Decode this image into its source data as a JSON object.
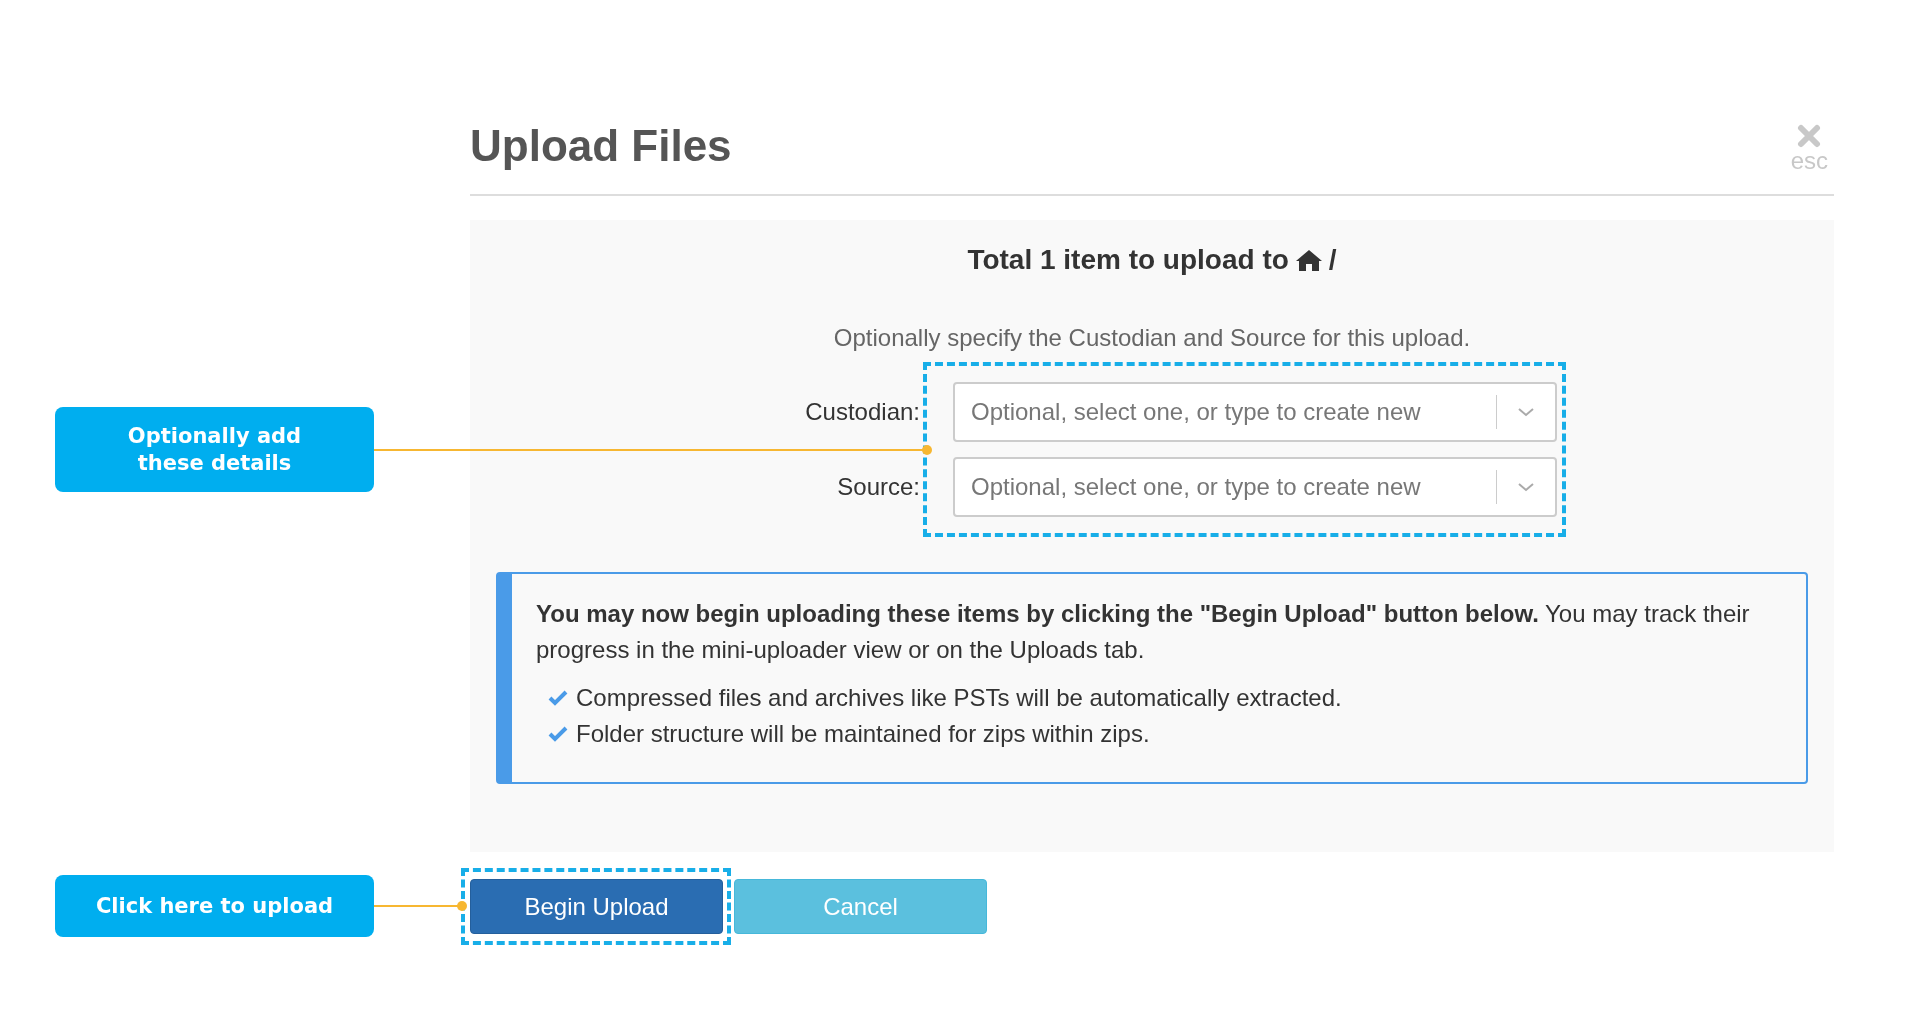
{
  "dialog": {
    "title": "Upload Files",
    "close_hint": "esc"
  },
  "summary": {
    "text": "Total 1 item to upload to",
    "path": "/"
  },
  "instructions": "Optionally specify the Custodian and Source for this upload.",
  "fields": [
    {
      "label": "Custodian:",
      "placeholder": "Optional, select one, or type to create new"
    },
    {
      "label": "Source:",
      "placeholder": "Optional, select one, or type to create new"
    }
  ],
  "notice": {
    "text": "**You may now begin uploading these items by clicking the \"Begin Upload\" button below.** You may track their progress in the mini-uploader view or on the Uploads tab.",
    "bullets": [
      "Compressed files and archives like PSTs will be automatically extracted.",
      "Folder structure will be maintained for zips within zips."
    ]
  },
  "buttons": [
    {
      "label": "Begin Upload",
      "kind": "primary"
    },
    {
      "label": "Cancel",
      "kind": "secondary"
    }
  ],
  "annotations": [
    {
      "text": "Optionally add these details"
    },
    {
      "text": "Click here to upload"
    }
  ]
}
